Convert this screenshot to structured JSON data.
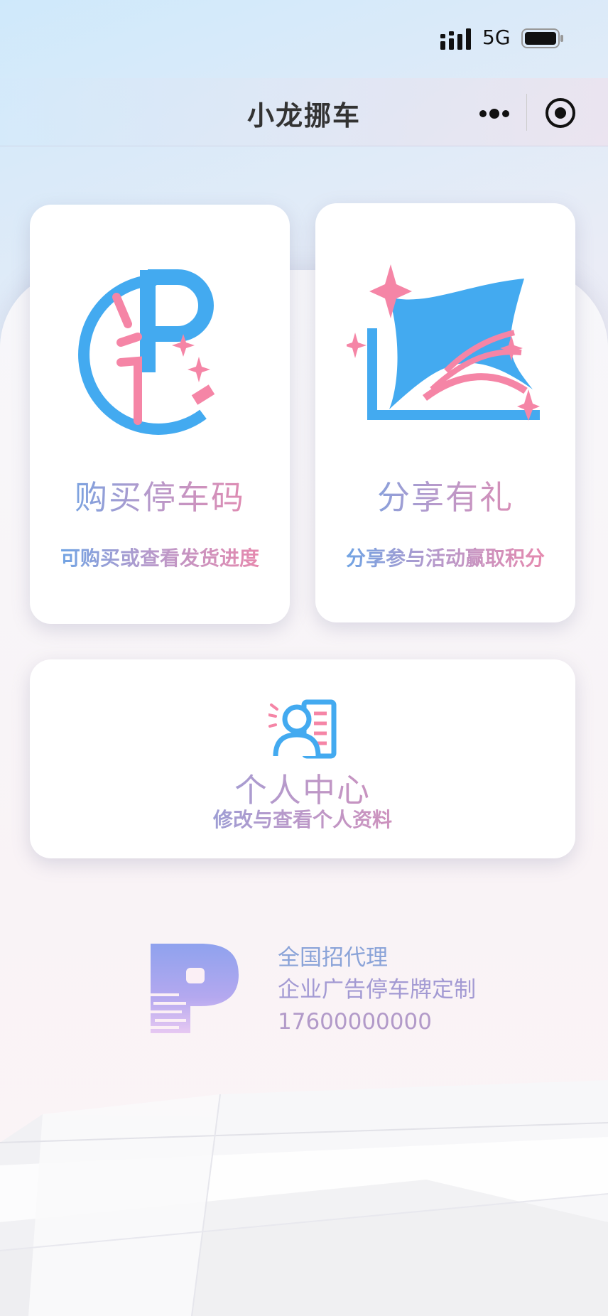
{
  "status_bar": {
    "network": "5G"
  },
  "nav": {
    "title": "小龙挪车",
    "more_icon": "more-dots-icon",
    "record_icon": "record-target-icon"
  },
  "cards": {
    "buy": {
      "title": "购买停车码",
      "subtitle": "可购买或查看发货进度",
      "icon": "parking-code-icon"
    },
    "share": {
      "title": "分享有礼",
      "subtitle": "分享参与活动赢取积分",
      "icon": "share-gift-icon"
    },
    "user": {
      "title": "个人中心",
      "subtitle": "修改与查看个人资料",
      "icon": "user-profile-icon"
    }
  },
  "promo": {
    "logo_icon": "parking-p-logo-icon",
    "line1": "全国招代理",
    "line2": "企业广告停车牌定制",
    "phone": "17600000000"
  },
  "colors": {
    "blue": "#43aaf0",
    "pink": "#f585a6",
    "text_dark": "#333333"
  }
}
